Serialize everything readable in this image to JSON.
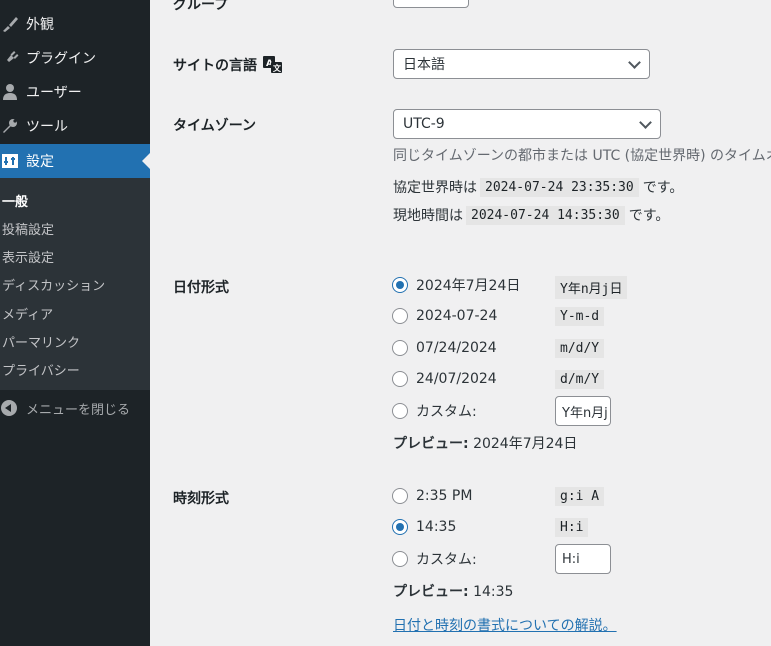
{
  "sidebar": {
    "items": [
      {
        "label": "外観",
        "icon": "paintbrush-icon"
      },
      {
        "label": "プラグイン",
        "icon": "plugin-icon"
      },
      {
        "label": "ユーザー",
        "icon": "user-icon"
      },
      {
        "label": "ツール",
        "icon": "wrench-icon"
      },
      {
        "label": "設定",
        "icon": "settings-icon"
      }
    ],
    "submenu": [
      "一般",
      "投稿設定",
      "表示設定",
      "ディスカッション",
      "メディア",
      "パーマリンク",
      "プライバシー"
    ],
    "collapse_label": "メニューを閉じる"
  },
  "main": {
    "group_label": "グループ",
    "site_language": {
      "label": "サイトの言語",
      "value": "日本語"
    },
    "timezone": {
      "label": "タイムゾーン",
      "value": "UTC-9",
      "description": "同じタイムゾーンの都市または UTC (協定世界時) のタイムオ",
      "utc_prefix": "協定世界時は",
      "utc_time": "2024-07-24 23:35:30",
      "utc_suffix": "です。",
      "local_prefix": "現地時間は",
      "local_time": "2024-07-24 14:35:30",
      "local_suffix": "です。"
    },
    "date_format": {
      "label": "日付形式",
      "options": [
        {
          "label": "2024年7月24日",
          "code": "Y年n月j日",
          "checked": true
        },
        {
          "label": "2024-07-24",
          "code": "Y-m-d",
          "checked": false
        },
        {
          "label": "07/24/2024",
          "code": "m/d/Y",
          "checked": false
        },
        {
          "label": "24/07/2024",
          "code": "d/m/Y",
          "checked": false
        }
      ],
      "custom_label": "カスタム:",
      "custom_value": "Y年n月j日",
      "preview_label": "プレビュー:",
      "preview_value": "2024年7月24日"
    },
    "time_format": {
      "label": "時刻形式",
      "options": [
        {
          "label": "2:35 PM",
          "code": "g:i A",
          "checked": false
        },
        {
          "label": "14:35",
          "code": "H:i",
          "checked": true
        }
      ],
      "custom_label": "カスタム:",
      "custom_value": "H:i",
      "preview_label": "プレビュー:",
      "preview_value": "14:35"
    },
    "help_link": "日付と時刻の書式についての解説。"
  },
  "colors": {
    "accent": "#2271b1",
    "sidebar_bg": "#1d2327",
    "submenu_bg": "#2c3338",
    "page_bg": "#f0f0f1"
  }
}
